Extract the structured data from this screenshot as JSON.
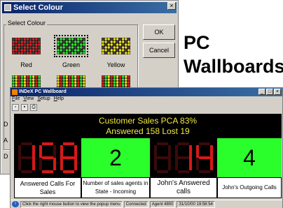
{
  "dialog": {
    "title": "Select Colour",
    "close_glyph": "×",
    "group_label": "Select Colour",
    "ok_label": "OK",
    "cancel_label": "Cancel",
    "swatches": [
      {
        "label": "Red",
        "color": "#e02020",
        "selected": false
      },
      {
        "label": "Green",
        "color": "#2ee82e",
        "selected": true
      },
      {
        "label": "Yellow",
        "color": "#f0e020",
        "selected": false
      }
    ],
    "lower_row_colors": [
      "#2ee82e",
      "#f0e020",
      "#e02020"
    ],
    "left_edge_letters": [
      "D",
      "A",
      "D"
    ]
  },
  "caption": {
    "line1": "PC",
    "line2": "Wallboards"
  },
  "wallboard": {
    "title": "INDeX PC Wallboard",
    "menu": [
      "File",
      "View",
      "Setup",
      "Help"
    ],
    "toolbar_icons": [
      "new-icon",
      "save-icon",
      "print-icon"
    ],
    "banner": {
      "line1": "Customer Sales PCA 83%",
      "line2": "Answered 158 Lost 19"
    },
    "tiles": [
      {
        "display": "158",
        "caption": "Answered Calls For Sales",
        "style": "led"
      },
      {
        "display": "2",
        "caption": "Number of sales agents in State - Incoming",
        "style": "plain"
      },
      {
        "display": "14",
        "caption": "John's Answered calls",
        "style": "led"
      },
      {
        "display": "4",
        "caption": "John's Outgoing Calls",
        "style": "plain"
      }
    ],
    "status": {
      "hint": "Click the right mouse button to view the popup menu",
      "connection": "Connected",
      "agent": "Agent 4800",
      "timestamp": "31/10/00 19:58:54"
    }
  },
  "colors": {
    "led_red": "#d81818",
    "led_off": "#3a0a0a",
    "tile_green": "#2bff2b",
    "banner_text": "#f2ea3e"
  }
}
